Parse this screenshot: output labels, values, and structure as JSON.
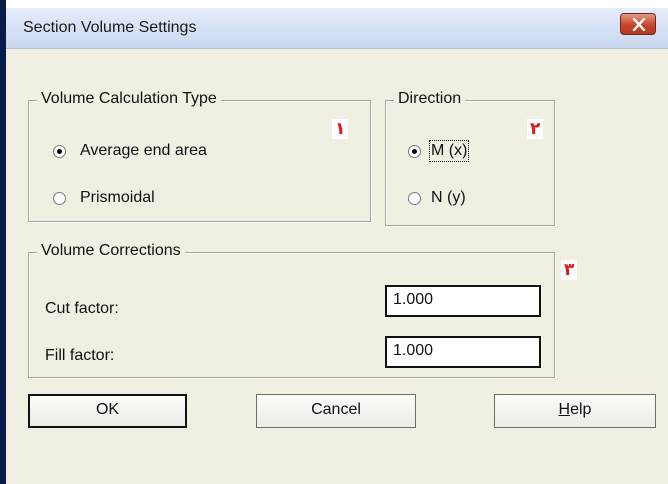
{
  "window": {
    "title": "Section Volume Settings"
  },
  "volume_calculation_type": {
    "legend": "Volume Calculation Type",
    "options": [
      {
        "label": "Average end area",
        "selected": true
      },
      {
        "label": "Prismoidal",
        "selected": false
      }
    ],
    "marker": "١"
  },
  "direction": {
    "legend": "Direction",
    "options": [
      {
        "label": "M (x)",
        "selected": true
      },
      {
        "label": "N (y)",
        "selected": false
      }
    ],
    "marker": "٢"
  },
  "volume_corrections": {
    "legend": "Volume Corrections",
    "cut_factor": {
      "label": "Cut factor:",
      "value": "1.000"
    },
    "fill_factor": {
      "label": "Fill factor:",
      "value": "1.000"
    },
    "marker": "٣"
  },
  "buttons": {
    "ok": "OK",
    "cancel": "Cancel",
    "help_mnemonic": "H",
    "help_rest": "elp"
  },
  "colors": {
    "marker_red": "#e01818",
    "dialog_bg": "#f1efe2",
    "titlebar": "#d4e0f5",
    "close_button": "#c6452a"
  },
  "icons": {
    "close": "close-x-icon"
  }
}
